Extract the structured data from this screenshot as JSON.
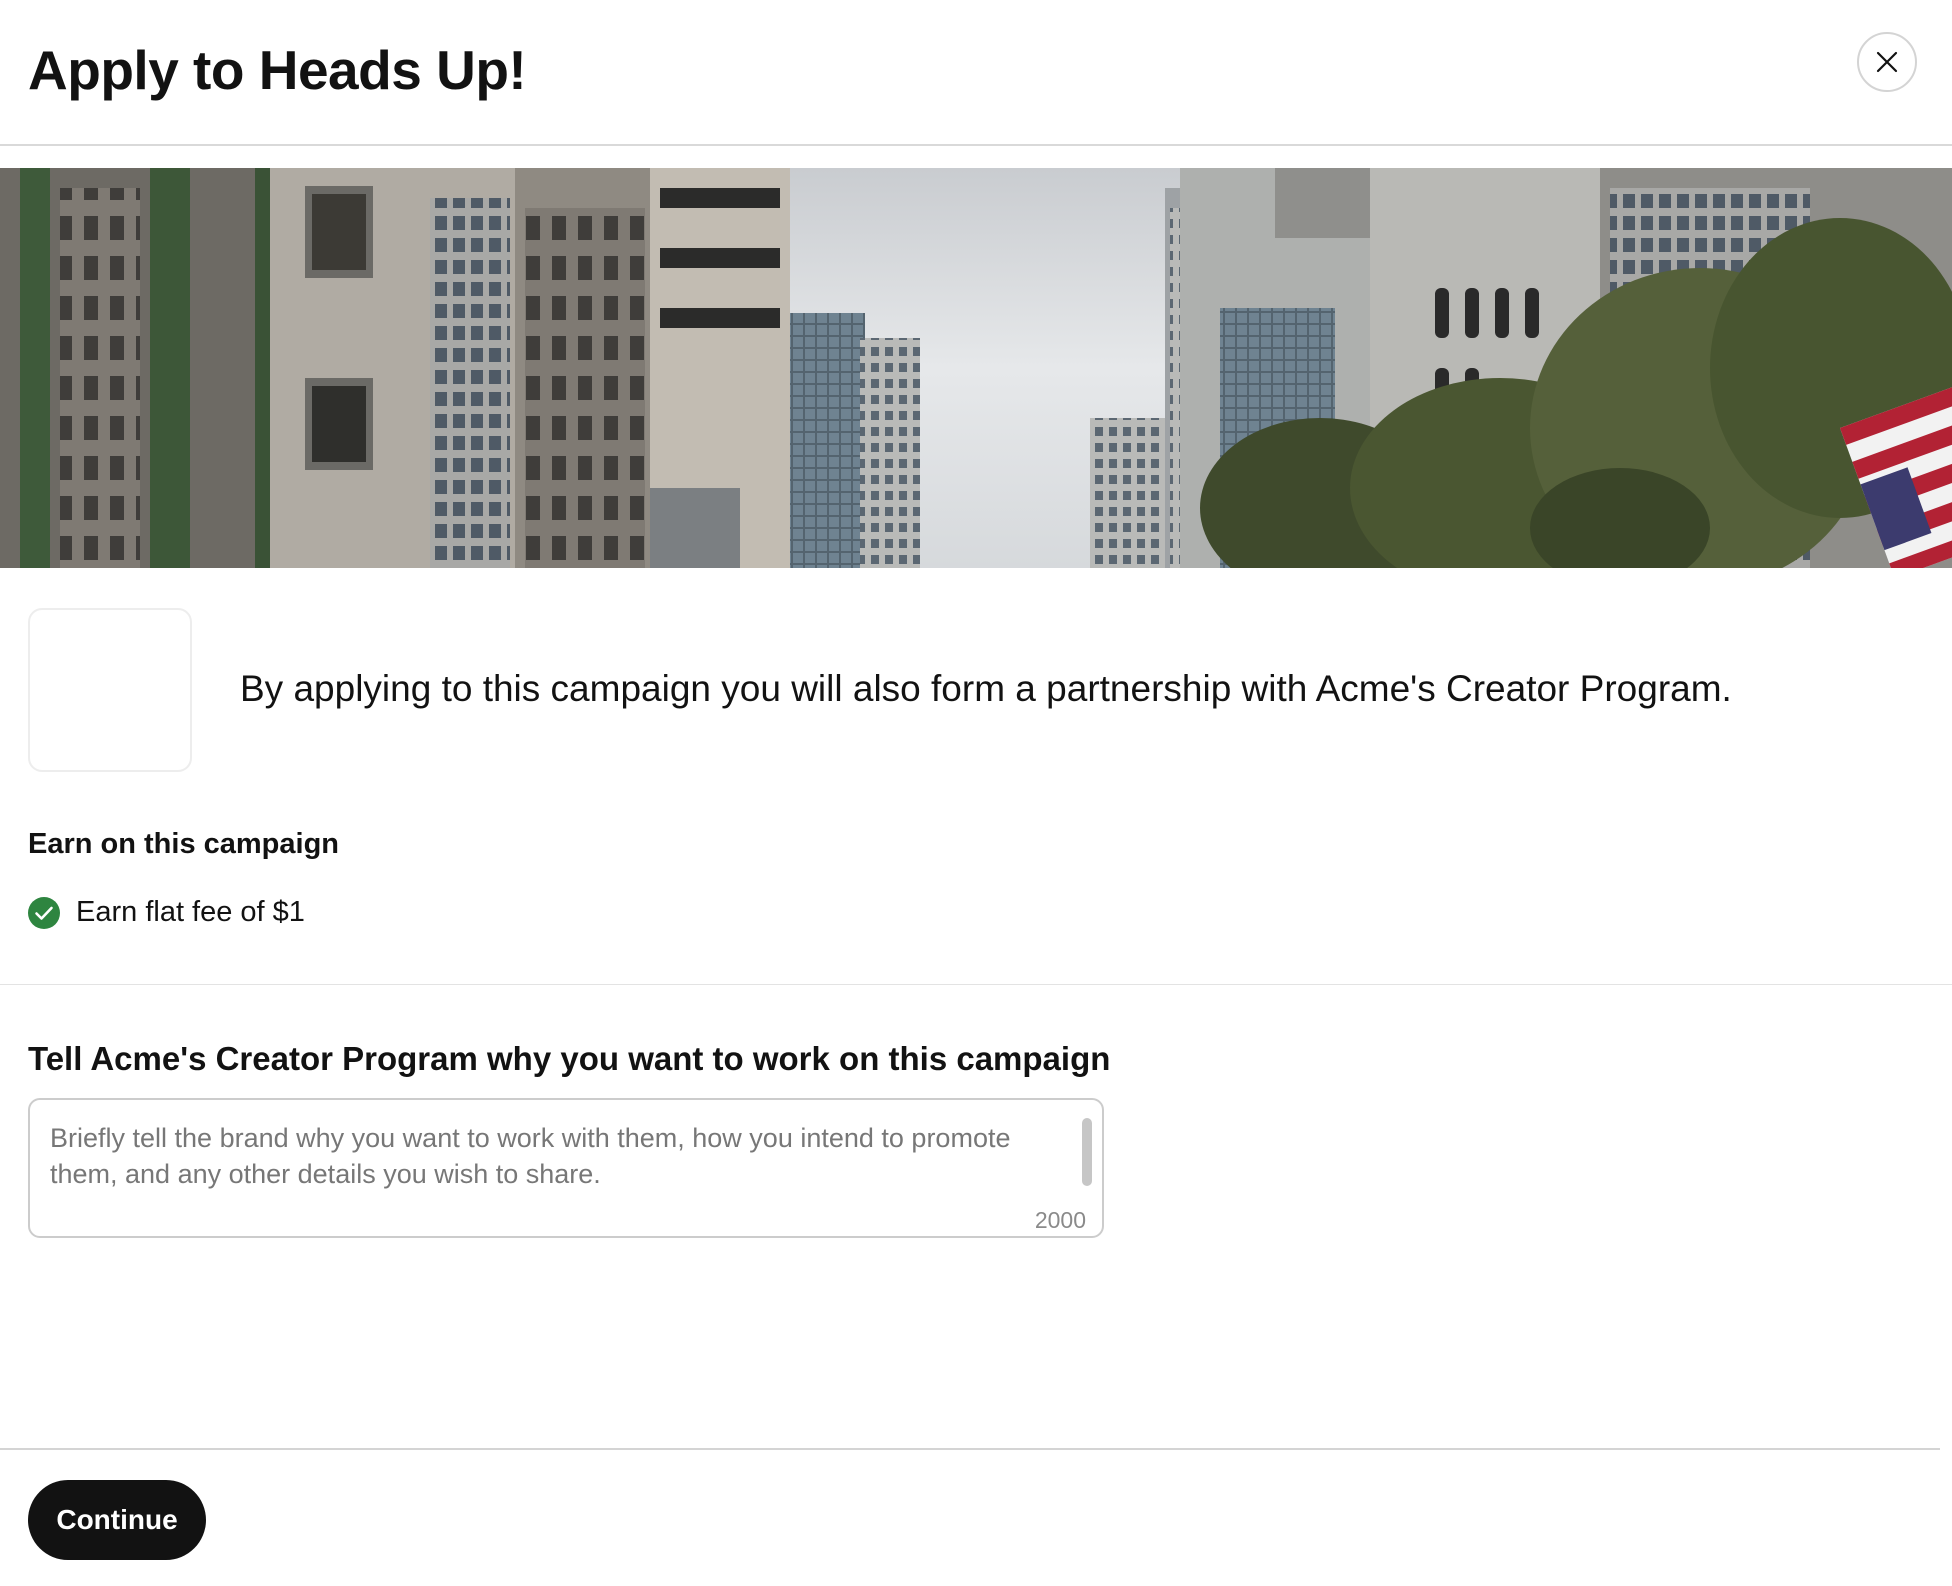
{
  "modal": {
    "title": "Apply to Heads Up!"
  },
  "partnership": {
    "text": "By applying to this campaign you will also form a partnership with Acme's Creator Program."
  },
  "earn": {
    "heading": "Earn on this campaign",
    "item": "Earn flat fee of $1"
  },
  "message": {
    "heading": "Tell Acme's Creator Program why you want to work on this campaign",
    "placeholder": "Briefly tell the brand why you want to work with them, how you intend to promote them, and any other details you wish to share.",
    "value": "",
    "char_limit": "2000"
  },
  "footer": {
    "continue_label": "Continue"
  },
  "colors": {
    "primary_button": "#121212",
    "success_check": "#2e8540"
  },
  "icons": {
    "close": "close-icon",
    "check": "check-circle-icon"
  }
}
